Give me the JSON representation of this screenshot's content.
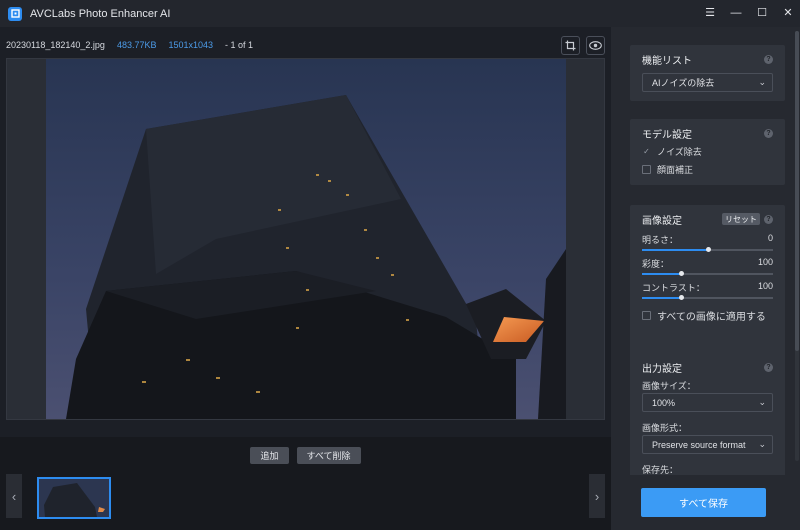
{
  "app": {
    "title": "AVCLabs Photo Enhancer AI"
  },
  "window_controls": {
    "menu": "☰",
    "minimize": "—",
    "maximize": "☐",
    "close": "✕"
  },
  "file_info": {
    "filename": "20230118_182140_2.jpg",
    "size": "483.77KB",
    "resolution": "1501x1043",
    "page": "- 1 of 1"
  },
  "toolbar": {
    "crop_icon": "crop-icon",
    "preview_icon": "eye-icon"
  },
  "actions": {
    "add_label": "追加",
    "delete_all_label": "すべて削除"
  },
  "thumbnail_nav": {
    "prev": "‹",
    "next": "›"
  },
  "features": {
    "title": "機能リスト",
    "help": "?",
    "selected": "AIノイズの除去",
    "chevron": "⌄"
  },
  "model": {
    "title": "モデル設定",
    "help": "?",
    "options": [
      {
        "label": "ノイズ除去",
        "checked": true,
        "mark": "✓"
      },
      {
        "label": "顔面補正",
        "checked": false,
        "mark": ""
      }
    ]
  },
  "image_settings": {
    "title": "画像設定",
    "help": "?",
    "reset_label": "リセット",
    "sliders": [
      {
        "label": "明るさ：",
        "value": "0",
        "fraction": 0.5
      },
      {
        "label": "彩度：",
        "value": "100",
        "fraction": 0.3
      },
      {
        "label": "コントラスト：",
        "value": "100",
        "fraction": 0.3
      }
    ],
    "apply_all_label": "すべての画像に適用する"
  },
  "output": {
    "title": "出力設定",
    "help": "?",
    "size_label": "画像サイズ：",
    "size_value": "100%",
    "format_label": "画像形式：",
    "format_value": "Preserve source format",
    "dest_label": "保存先：",
    "chevron": "⌄"
  },
  "save_all_label": "すべて保存",
  "colors": {
    "accent": "#2d8cf0",
    "save_button": "#3b9bf5",
    "info_blue": "#4c9be8"
  }
}
